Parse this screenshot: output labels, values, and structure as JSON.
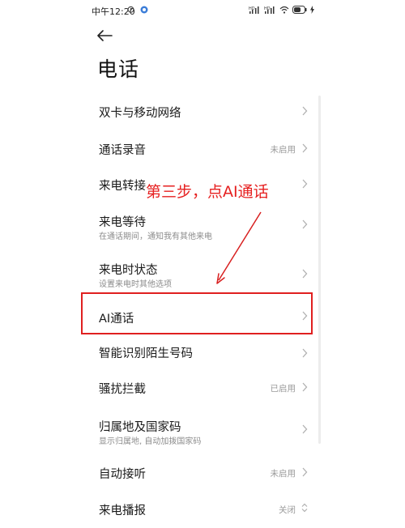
{
  "status_bar": {
    "time": "中午12:20",
    "icons": [
      "alarm-clock-icon",
      "app-notification-icon",
      "signal-hd-icon",
      "signal-hd-icon",
      "wifi-icon",
      "battery-icon",
      "charging-icon"
    ]
  },
  "header": {
    "back_icon": "arrow-left-icon",
    "title": "电话"
  },
  "settings": {
    "items": [
      {
        "title": "双卡与移动网络",
        "subtitle": "",
        "value": ""
      },
      {
        "title": "通话录音",
        "subtitle": "",
        "value": "未启用"
      },
      {
        "title": "来电转接",
        "subtitle": "",
        "value": ""
      },
      {
        "title": "来电等待",
        "subtitle": "在通话期间，通知我有其他来电",
        "value": ""
      },
      {
        "title": "来电时状态",
        "subtitle": "设置来电时其他选项",
        "value": ""
      },
      {
        "title": "AI通话",
        "subtitle": "",
        "value": ""
      },
      {
        "title": "智能识别陌生号码",
        "subtitle": "",
        "value": ""
      },
      {
        "title": "骚扰拦截",
        "subtitle": "",
        "value": "已启用"
      },
      {
        "title": "归属地及国家码",
        "subtitle": "显示归属地, 自动加拨国家码",
        "value": ""
      },
      {
        "title": "自动接听",
        "subtitle": "",
        "value": "未启用"
      },
      {
        "title": "来电播报",
        "subtitle": "",
        "value": "关闭"
      }
    ]
  },
  "annotation": {
    "text": "第三步，点AI通话",
    "color": "#e62020"
  }
}
